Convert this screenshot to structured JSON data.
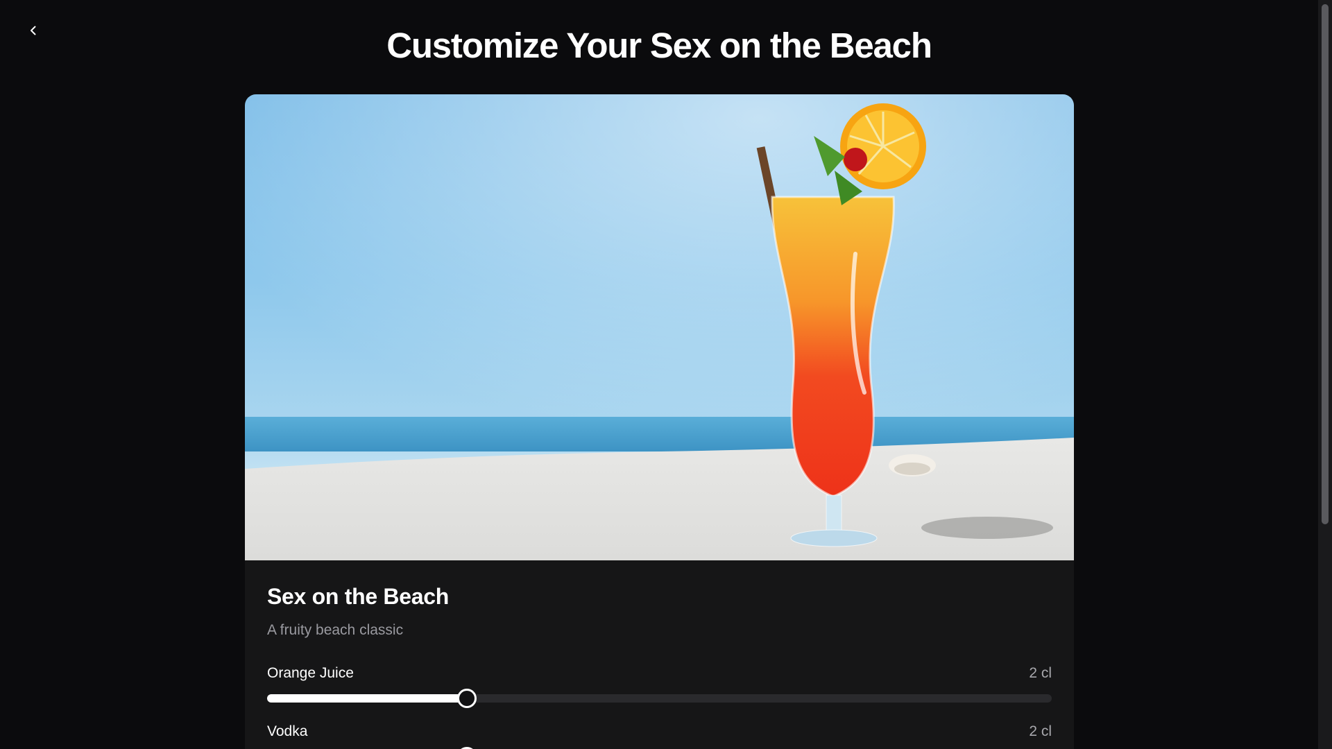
{
  "header": {
    "title": "Customize Your Sex on the Beach"
  },
  "drink": {
    "name": "Sex on the Beach",
    "description": "A fruity beach classic",
    "image_subject": "cocktail-on-beach"
  },
  "ingredients": [
    {
      "name": "Orange Juice",
      "amount": "2 cl",
      "level": 0.255
    },
    {
      "name": "Vodka",
      "amount": "2 cl",
      "level": 0.255
    }
  ],
  "colors": {
    "background": "#0b0b0d",
    "card": "#161617",
    "slider_track": "#2a2a2d",
    "slider_fill": "#ffffff",
    "muted_text": "#9a9aa0"
  }
}
